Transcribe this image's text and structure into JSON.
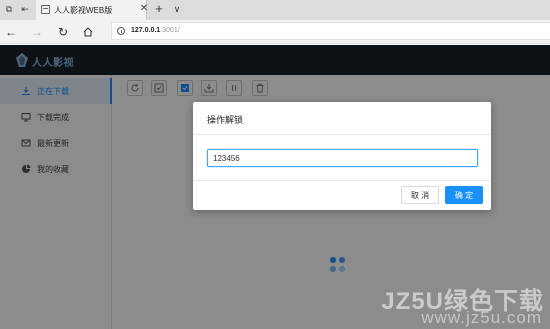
{
  "browser": {
    "tab_title": "人人影视WEB版",
    "url_host": "127.0.0.1",
    "url_rest": ":3001/"
  },
  "app": {
    "logo_text": "人人影视",
    "accent_color": "#1890ff",
    "header_bg": "#1a1f27"
  },
  "sidebar": {
    "items": [
      {
        "label": "正在下载",
        "icon": "download-icon",
        "active": true
      },
      {
        "label": "下载完成",
        "icon": "monitor-icon",
        "active": false
      },
      {
        "label": "最新更新",
        "icon": "mail-icon",
        "active": false
      },
      {
        "label": "我的收藏",
        "icon": "pie-chart-icon",
        "active": false
      }
    ]
  },
  "toolbar": {
    "buttons": [
      "refresh-icon",
      "check-square-icon",
      "filled-square-icon",
      "download-tray-icon",
      "pause-icon",
      "trash-icon"
    ]
  },
  "dialog": {
    "title": "操作解锁",
    "input_value": "123456",
    "cancel_label": "取 消",
    "ok_label": "确 定"
  },
  "watermark": {
    "main": "JZ5U绿色下载",
    "url": "www.jz5u.com"
  }
}
